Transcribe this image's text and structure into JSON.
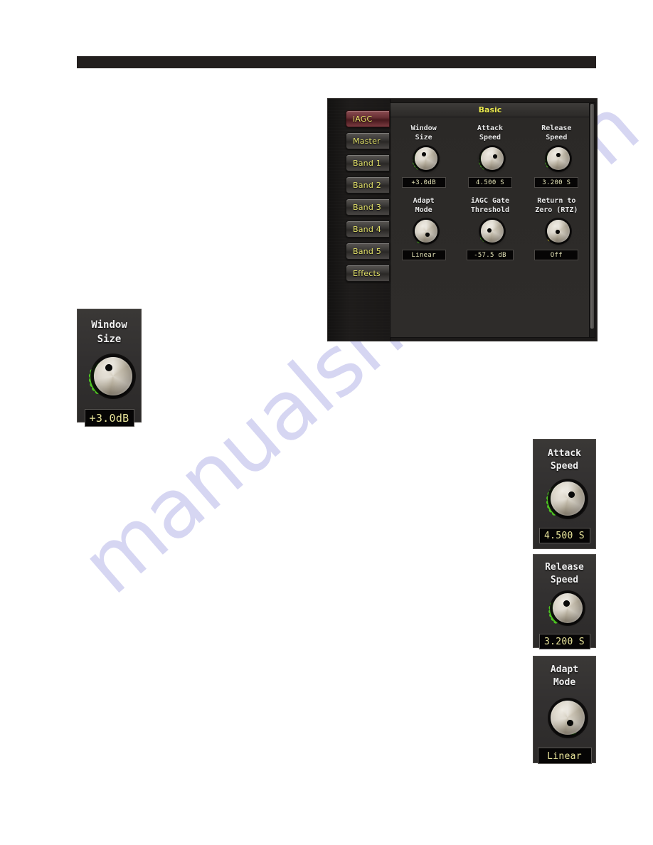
{
  "page": {
    "background": "#ffffff",
    "watermark": "manualshive.com",
    "watermark_color": "#d6d6f2"
  },
  "topbar": {
    "color": "#231f1e"
  },
  "plugin": {
    "pane_title": "Basic",
    "title_color": "#eaea4f",
    "sidebar": {
      "items": [
        {
          "label": "iAGC",
          "selected": true
        },
        {
          "label": "Master",
          "selected": false
        },
        {
          "label": "Band 1",
          "selected": false
        },
        {
          "label": "Band 2",
          "selected": false
        },
        {
          "label": "Band 3",
          "selected": false
        },
        {
          "label": "Band 4",
          "selected": false
        },
        {
          "label": "Band 5",
          "selected": false
        },
        {
          "label": "Effects",
          "selected": false
        }
      ],
      "selected_color": "#47191d",
      "label_color": "#e3e26a"
    },
    "controls": [
      {
        "caption": "Window\nSize",
        "value": "+3.0dB"
      },
      {
        "caption": "Attack\nSpeed",
        "value": "4.500 S"
      },
      {
        "caption": "Release\nSpeed",
        "value": "3.200 S"
      },
      {
        "caption": "Adapt\nMode",
        "value": "Linear"
      },
      {
        "caption": "iAGC Gate\nThreshold",
        "value": "-57.5 dB"
      },
      {
        "caption": "Return to\nZero (RTZ)",
        "value": "Off"
      }
    ]
  },
  "callouts": [
    {
      "id": "window",
      "caption": "Window\nSize",
      "value": "+3.0dB"
    },
    {
      "id": "attack",
      "caption": "Attack\nSpeed",
      "value": "4.500 S"
    },
    {
      "id": "release",
      "caption": "Release\nSpeed",
      "value": "3.200 S"
    },
    {
      "id": "adapt",
      "caption": "Adapt\nMode",
      "value": "Linear"
    }
  ],
  "colors": {
    "led_green": "#4ec722",
    "led_yellow": "#d8c43a",
    "display_text": "#e5e4b8",
    "panel_bg": "#2e2c2a"
  }
}
